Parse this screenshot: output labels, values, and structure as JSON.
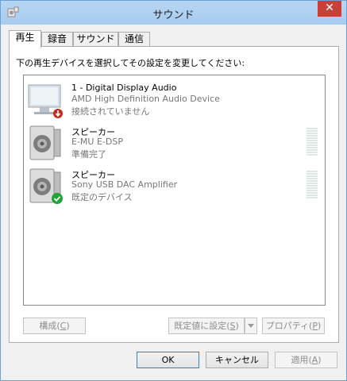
{
  "window": {
    "title": "サウンド",
    "close_label": "✕"
  },
  "tabs": [
    {
      "label": "再生",
      "active": true
    },
    {
      "label": "録音",
      "active": false
    },
    {
      "label": "サウンド",
      "active": false
    },
    {
      "label": "通信",
      "active": false
    }
  ],
  "playback": {
    "instruction": "下の再生デバイスを選択してその設定を変更してください:",
    "devices": [
      {
        "name": "1 - Digital Display Audio",
        "description": "AMD High Definition Audio Device",
        "status": "接続されていません",
        "icon": "monitor-icon",
        "badge": "disconnected-icon",
        "meter": false
      },
      {
        "name": "スピーカー",
        "description": "E-MU E-DSP",
        "status": "準備完了",
        "icon": "speaker-icon",
        "badge": "",
        "meter": true
      },
      {
        "name": "スピーカー",
        "description": "Sony USB DAC Amplifier",
        "status": "既定のデバイス",
        "icon": "speaker-icon",
        "badge": "default-check-icon",
        "meter": true
      }
    ],
    "configure_label": "構成",
    "configure_key": "C",
    "set_default_label": "既定値に設定",
    "set_default_key": "S",
    "properties_label": "プロパティ",
    "properties_key": "P"
  },
  "footer": {
    "ok_label": "OK",
    "cancel_label": "キャンセル",
    "apply_label": "適用",
    "apply_key": "A"
  },
  "colors": {
    "titlebar": "#a6cbee",
    "close": "#c7403a",
    "check": "#21a336",
    "disconnected": "#c42b1c"
  }
}
